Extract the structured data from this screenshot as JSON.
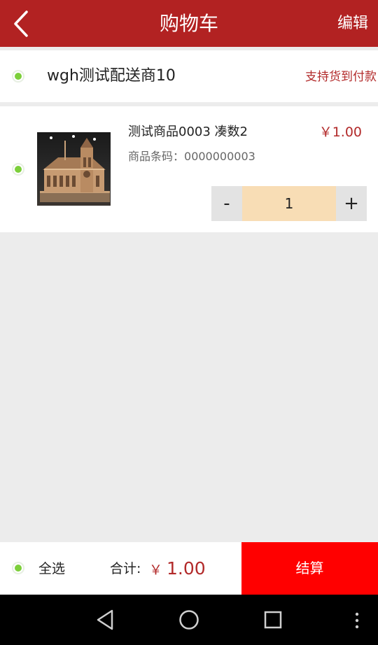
{
  "theme": {
    "brand": "#b22222",
    "price_color": "#b22a2a",
    "checkout_bg": "#ff0000",
    "radio_color": "#7ccf3a",
    "qty_bg": "#f8ddb5"
  },
  "header": {
    "title": "购物车",
    "edit_label": "编辑",
    "back_icon": "chevron-left-icon"
  },
  "shop": {
    "name": "wgh测试配送商10",
    "cod_label": "支持货到付款",
    "selected": true
  },
  "cart_items": [
    {
      "name": "测试商品0003 凑数2",
      "price": "￥1.00",
      "barcode_label": "商品条码：",
      "barcode": "0000000003",
      "quantity": "1",
      "minus_label": "-",
      "plus_label": "+",
      "selected": true,
      "image_icon": "cathedral-model-image"
    }
  ],
  "footer": {
    "select_all_label": "全选",
    "select_all_selected": true,
    "total_label": "合计:",
    "currency_symbol": "￥",
    "total_amount": "1.00",
    "checkout_label": "结算"
  },
  "system_nav": {
    "back_icon": "triangle-back-icon",
    "home_icon": "circle-home-icon",
    "recents_icon": "square-recents-icon",
    "menu_icon": "vertical-dots-icon"
  }
}
